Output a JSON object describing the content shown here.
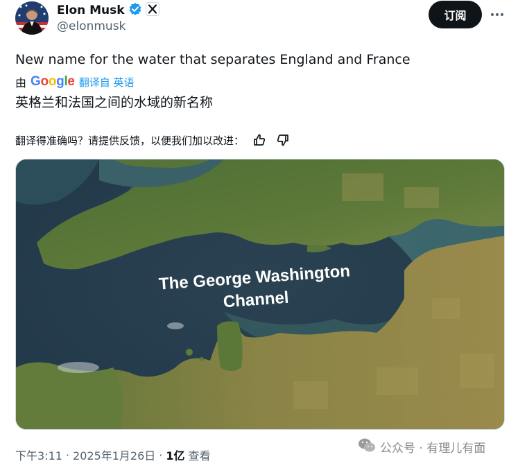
{
  "author": {
    "name": "Elon Musk",
    "handle": "@elonmusk",
    "verified_icon": "verified-badge-icon",
    "affiliate_icon": "x-logo-icon"
  },
  "actions": {
    "subscribe_label": "订阅",
    "more_icon": "more-icon"
  },
  "tweet": {
    "text": "New name for the water that separates England and France",
    "translation_prefix": "由",
    "google_logo": "Google",
    "translation_link": "翻译自 英语",
    "translated_text": "英格兰和法国之间的水域的新名称",
    "feedback_prompt": "翻译得准确吗？请提供反馈，以便我们加以改进：",
    "map_caption_line1": "The George Washington",
    "map_caption_line2": "Channel"
  },
  "meta": {
    "time": "下午3:11",
    "separator": "·",
    "date": "2025年1月26日",
    "views_count": "1亿",
    "views_label": "查看"
  },
  "watermark": {
    "text": "公众号 · 有理儿有面"
  },
  "colors": {
    "accent": "#1d9bf0",
    "text": "#0f1419",
    "muted": "#536471",
    "sea": "#2d4656"
  }
}
